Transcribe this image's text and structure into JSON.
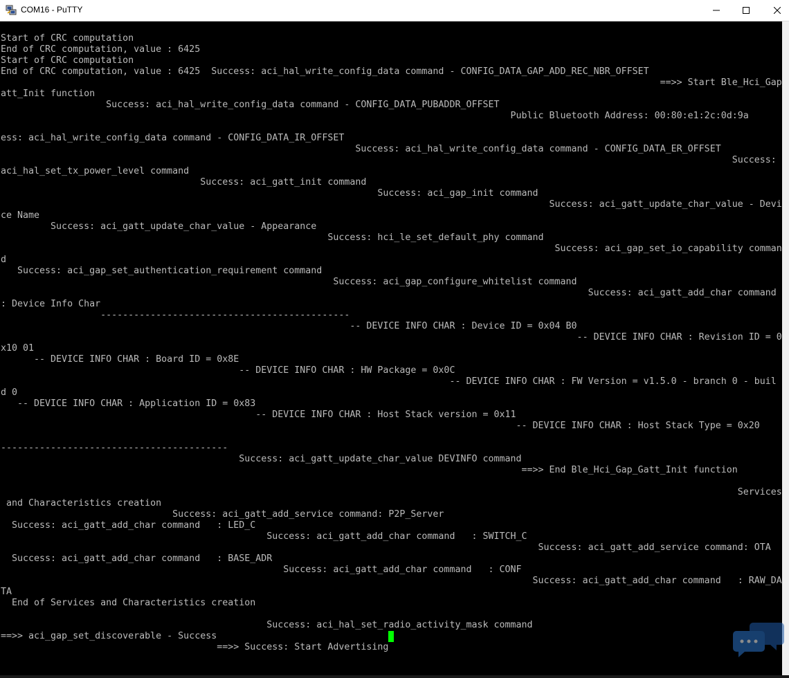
{
  "window": {
    "title": "COM16 - PuTTY",
    "icons": {
      "app": "putty-computers-icon",
      "minimize": "minimize-icon",
      "maximize": "maximize-icon",
      "close": "close-icon",
      "watermark": "chat-bubble-watermark-icon"
    },
    "colors": {
      "background": "#000000",
      "text": "#bbbbbb",
      "cursor": "#00ff00"
    }
  },
  "terminal": {
    "lines": [
      "Start of CRC computation",
      "End of CRC computation, value : 6425",
      "Start of CRC computation",
      "End of CRC computation, value : 6425  Success: aci_hal_write_config_data command - CONFIG_DATA_GAP_ADD_REC_NBR_OFFSET",
      "                                                                                                                       ==>> Start Ble_Hci_Gap_G",
      "att_Init function",
      "                   Success: aci_hal_write_config_data command - CONFIG_DATA_PUBADDR_OFFSET",
      "                                                                                            Public Bluetooth Address: 00:80:e1:2c:0d:9a",
      "                                                                                                                                             Succ",
      "ess: aci_hal_write_config_data command - CONFIG_DATA_IR_OFFSET",
      "                                                                Success: aci_hal_write_config_data command - CONFIG_DATA_ER_OFFSET",
      "                                                                                                                                    Success: ",
      "aci_hal_set_tx_power_level command",
      "                                    Success: aci_gatt_init command",
      "                                                                    Success: aci_gap_init command",
      "                                                                                                   Success: aci_gatt_update_char_value - Devi",
      "ce Name",
      "         Success: aci_gatt_update_char_value - Appearance",
      "                                                           Success: hci_le_set_default_phy command",
      "                                                                                                    Success: aci_gap_set_io_capability comman",
      "d",
      "   Success: aci_gap_set_authentication_requirement command",
      "                                                            Success: aci_gap_configure_whitelist command",
      "                                                                                                          Success: aci_gatt_add_char command ",
      ": Device Info Char",
      "                  ---------------------------------------------",
      "                                                               -- DEVICE INFO CHAR : Device ID = 0x04 B0",
      "                                                                                                        -- DEVICE INFO CHAR : Revision ID = 0",
      "x10 01",
      "      -- DEVICE INFO CHAR : Board ID = 0x8E",
      "                                           -- DEVICE INFO CHAR : HW Package = 0x0C",
      "                                                                                 -- DEVICE INFO CHAR : FW Version = v1.5.0 - branch 0 - buil",
      "d 0",
      "   -- DEVICE INFO CHAR : Application ID = 0x83",
      "                                              -- DEVICE INFO CHAR : Host Stack version = 0x11",
      "                                                                                             -- DEVICE INFO CHAR : Host Stack Type = 0x20",
      "                                                                                                                                             ----",
      "-----------------------------------------",
      "                                           Success: aci_gatt_update_char_value DEVINFO command",
      "                                                                                              ==>> End Ble_Hci_Gap_Gatt_Init function",
      "",
      "                                                                                                                                     Services",
      " and Characteristics creation",
      "                               Success: aci_gatt_add_service command: P2P_Server",
      "  Success: aci_gatt_add_char command   : LED_C",
      "                                                Success: aci_gatt_add_char command   : SWITCH_C",
      "                                                                                                 Success: aci_gatt_add_service command: OTA",
      "  Success: aci_gatt_add_char command   : BASE_ADR",
      "                                                   Success: aci_gatt_add_char command   : CONF",
      "                                                                                                Success: aci_gatt_add_char command   : RAW_DA",
      "TA",
      "  End of Services and Characteristics creation",
      "",
      "                                                Success: aci_hal_set_radio_activity_mask command",
      "==>> aci_gap_set_discoverable - Success",
      "                                       ==>> Success: Start Advertising"
    ]
  }
}
